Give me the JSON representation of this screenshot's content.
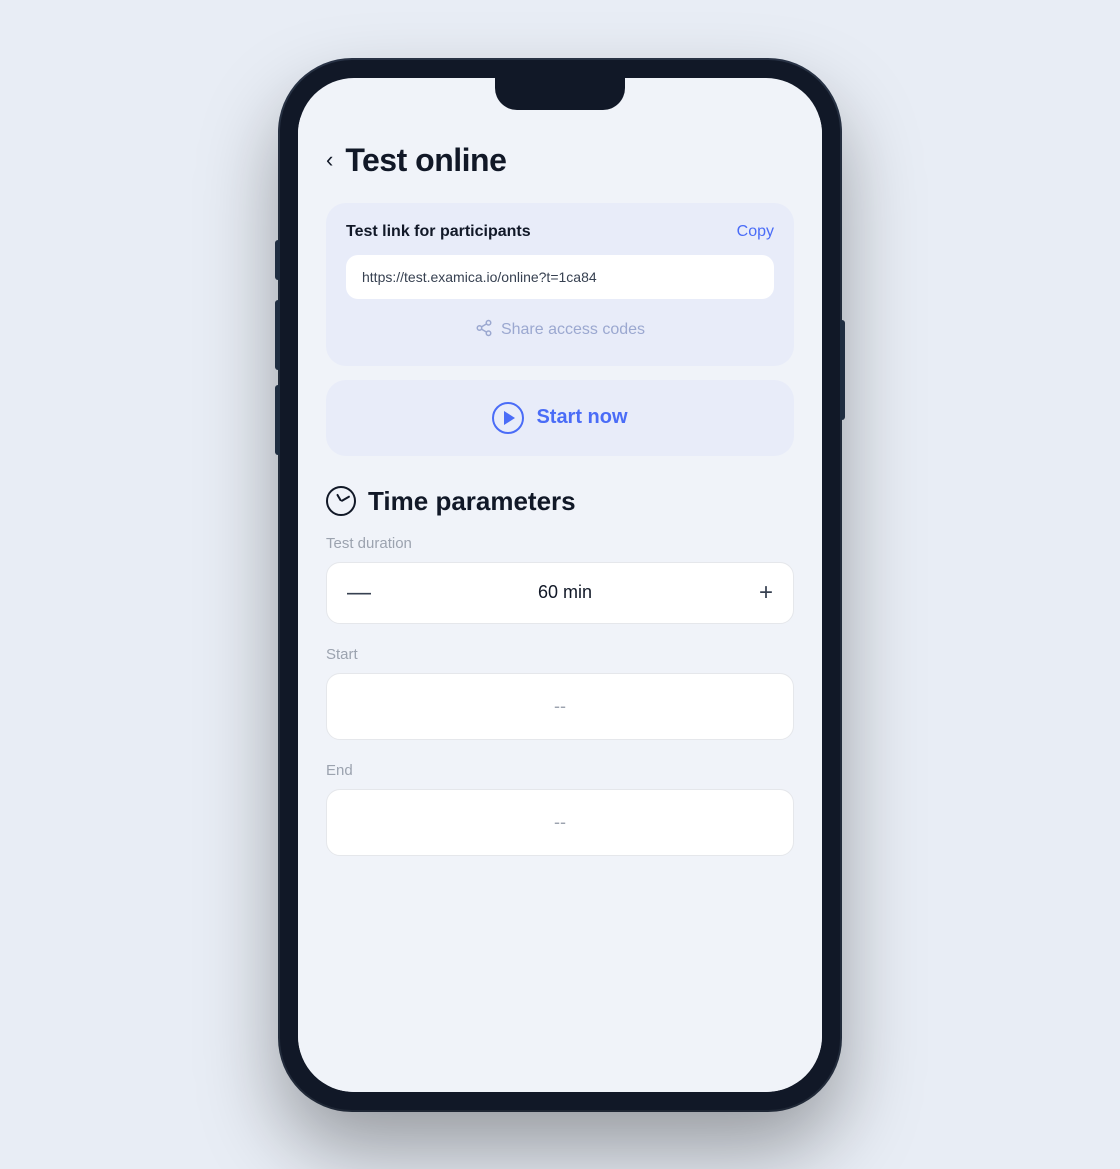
{
  "page": {
    "title": "Test online",
    "back_label": "‹"
  },
  "test_link_card": {
    "label": "Test link for participants",
    "copy_label": "Copy",
    "link_value": "https://test.examica.io/online?t=1ca84",
    "share_access_label": "Share access codes"
  },
  "start_now": {
    "label": "Start now"
  },
  "time_parameters": {
    "section_title": "Time parameters",
    "duration_label": "Test duration",
    "duration_value": "60 min",
    "start_label": "Start",
    "start_value": "--",
    "end_label": "End",
    "end_value": "--"
  },
  "icons": {
    "back": "‹",
    "minus": "—",
    "plus": "+"
  }
}
